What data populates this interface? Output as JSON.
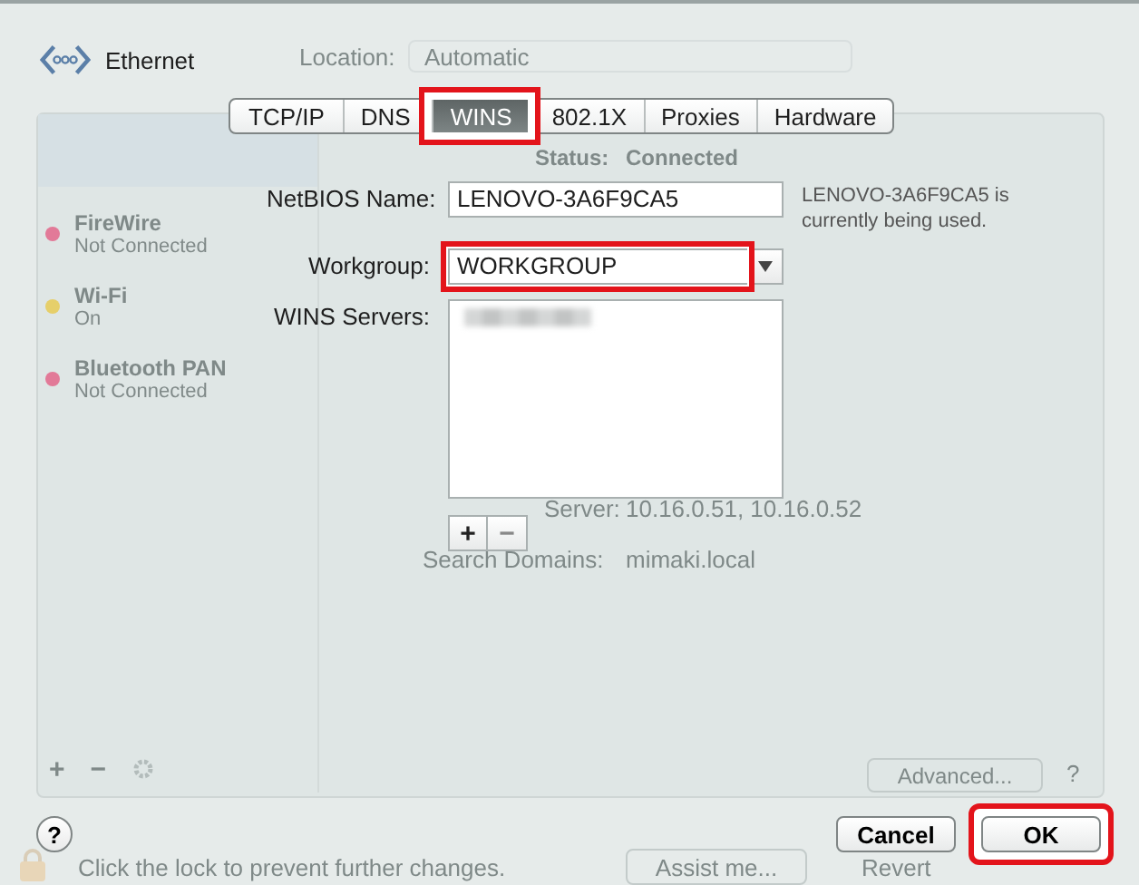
{
  "window": {
    "title": "Ethernet"
  },
  "background": {
    "location_label": "Location:",
    "location_value": "Automatic",
    "services": [
      {
        "name": "FireWire",
        "status": "Not Connected",
        "color": "#e27a98"
      },
      {
        "name": "Wi-Fi",
        "status": "On",
        "color": "#e6cf6a"
      },
      {
        "name": "Bluetooth PAN",
        "status": "Not Connected",
        "color": "#e27a98"
      }
    ],
    "sidebar_tools": [
      "+",
      "−"
    ],
    "status_label": "Status:",
    "status_value": "Connected",
    "dns_server_label": "Server:",
    "dns_server_value": "10.16.0.51, 10.16.0.52",
    "search_domains_label": "Search Domains:",
    "search_domains_value": "mimaki.local",
    "advanced_button": "Advanced...",
    "help_button": "?",
    "lock_text": "Click the lock to prevent further changes.",
    "assist_button": "Assist me...",
    "revert_button": "Revert"
  },
  "tabs": [
    {
      "label": "TCP/IP",
      "selected": false,
      "highlighted": false
    },
    {
      "label": "DNS",
      "selected": false,
      "highlighted": false
    },
    {
      "label": "WINS",
      "selected": true,
      "highlighted": true
    },
    {
      "label": "802.1X",
      "selected": false,
      "highlighted": false
    },
    {
      "label": "Proxies",
      "selected": false,
      "highlighted": false
    },
    {
      "label": "Hardware",
      "selected": false,
      "highlighted": false
    }
  ],
  "netbios": {
    "label": "NetBIOS Name:",
    "value": "LENOVO-3A6F9CA5",
    "note": "LENOVO-3A6F9CA5 is currently being used."
  },
  "workgroup": {
    "label": "Workgroup:",
    "value": "WORKGROUP",
    "highlighted": true
  },
  "wins_servers": {
    "label": "WINS Servers:"
  },
  "list_buttons": [
    "+",
    "−"
  ],
  "help_button": "?",
  "buttons": [
    {
      "label": "Cancel",
      "highlighted": false
    },
    {
      "label": "OK",
      "highlighted": true
    }
  ]
}
